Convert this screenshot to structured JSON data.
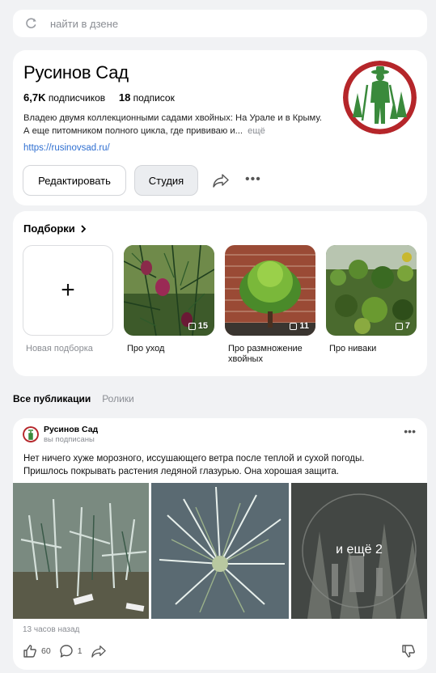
{
  "search": {
    "placeholder": "найти в дзене"
  },
  "channel": {
    "name": "Русинов Сад",
    "subscribers_count": "6,7K",
    "subscribers_label": "подписчиков",
    "subscriptions_count": "18",
    "subscriptions_label": "подписок",
    "description": "Владею двумя коллекционными садами хвойных: На Урале и в Крыму. А еще питомником полного цикла, где прививаю и...",
    "more": "ещё",
    "link": "https://rusinovsad.ru/",
    "edit_label": "Редактировать",
    "studio_label": "Студия"
  },
  "collections": {
    "heading": "Подборки",
    "new_label": "Новая подборка",
    "items": [
      {
        "title": "Про уход",
        "count": "15"
      },
      {
        "title": "Про размножение хвойных",
        "count": "11"
      },
      {
        "title": "Про ниваки",
        "count": "7"
      }
    ]
  },
  "tabs": [
    {
      "label": "Все публикации",
      "active": true
    },
    {
      "label": "Ролики",
      "active": false
    }
  ],
  "post": {
    "author": "Русинов Сад",
    "status": "вы подписаны",
    "text": "Нет ничего хуже морозного, иссушающего ветра после теплой и сухой погоды. Пришлось покрывать растения ледяной глазурью. Она хорошая защита.",
    "more_images_label": "и ещё 2",
    "time": "13 часов назад",
    "likes": "60",
    "comments": "1"
  },
  "colors": {
    "background": "#f1f2f4",
    "link": "#2f6fd1",
    "muted": "#8a8d93",
    "logo_green": "#3a8a3c",
    "logo_ring": "#b5262a"
  }
}
